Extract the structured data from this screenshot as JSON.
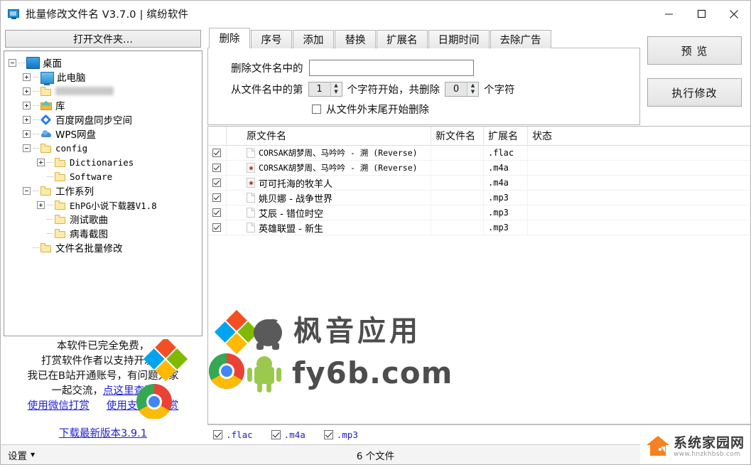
{
  "window": {
    "title": "批量修改文件名 V3.7.0 | 缤纷软件",
    "app_icon": "monitor-icon",
    "controls": {
      "minimize": "minimize-icon",
      "maximize": "maximize-icon",
      "close": "close-icon"
    }
  },
  "sidebar": {
    "open_folder_label": "打开文件夹…",
    "tree": [
      {
        "label": "桌面",
        "icon": "desktop-icon",
        "depth": 0,
        "expander": "minus",
        "redacted": false,
        "mono": false
      },
      {
        "label": "此电脑",
        "icon": "computer-icon",
        "depth": 1,
        "expander": "plus",
        "redacted": false,
        "mono": false
      },
      {
        "label": "",
        "icon": "folder-icon",
        "depth": 1,
        "expander": "plus",
        "redacted": true,
        "mono": false
      },
      {
        "label": "库",
        "icon": "library-icon",
        "depth": 1,
        "expander": "plus",
        "redacted": false,
        "mono": false
      },
      {
        "label": "百度网盘同步空间",
        "icon": "baidu-netdisk-icon",
        "depth": 1,
        "expander": "plus",
        "redacted": false,
        "mono": false
      },
      {
        "label": "WPS网盘",
        "icon": "wps-cloud-icon",
        "depth": 1,
        "expander": "plus",
        "redacted": false,
        "mono": false
      },
      {
        "label": "config",
        "icon": "folder-icon",
        "depth": 1,
        "expander": "minus",
        "redacted": false,
        "mono": true
      },
      {
        "label": "Dictionaries",
        "icon": "folder-icon",
        "depth": 2,
        "expander": "plus",
        "redacted": false,
        "mono": true
      },
      {
        "label": "Software",
        "icon": "folder-icon",
        "depth": 2,
        "expander": "none",
        "redacted": false,
        "mono": true
      },
      {
        "label": "工作系列",
        "icon": "folder-icon",
        "depth": 1,
        "expander": "minus",
        "redacted": false,
        "mono": false
      },
      {
        "label": "EhPG小说下载器V1.8",
        "icon": "folder-icon",
        "depth": 2,
        "expander": "plus",
        "redacted": false,
        "mono": true
      },
      {
        "label": "测试歌曲",
        "icon": "folder-icon",
        "depth": 2,
        "expander": "none",
        "redacted": false,
        "mono": false
      },
      {
        "label": "病毒截图",
        "icon": "folder-icon",
        "depth": 2,
        "expander": "none",
        "redacted": false,
        "mono": false
      },
      {
        "label": "文件名批量修改",
        "icon": "folder-icon",
        "depth": 1,
        "expander": "none",
        "redacted": false,
        "mono": false
      }
    ],
    "promo": {
      "line1": "本软件已完全免费，",
      "line2": "打赏软件作者以支持开发。",
      "line3": "我已在B站开通账号，有问题大家",
      "line4_prefix": "一起交流，",
      "line4_link": "点这里查看",
      "wechat_link": "使用微信打赏",
      "alipay_link": "使用支付宝打赏",
      "download_link": "下载最新版本3.9.1"
    }
  },
  "tabs": [
    {
      "label": "删除",
      "active": true
    },
    {
      "label": "序号",
      "active": false
    },
    {
      "label": "添加",
      "active": false
    },
    {
      "label": "替换",
      "active": false
    },
    {
      "label": "扩展名",
      "active": false
    },
    {
      "label": "日期时间",
      "active": false
    },
    {
      "label": "去除广告",
      "active": false
    }
  ],
  "delete_panel": {
    "remove_label": "删除文件名中的",
    "remove_value": "",
    "remove_placeholder": "",
    "from_label": "从文件名中的第",
    "start_value": "1",
    "mid_label": "个字符开始，共删除",
    "count_value": "0",
    "end_label": "个字符",
    "tail_checkbox_label": "从文件外末尾开始删除",
    "tail_checkbox_checked": false
  },
  "actions": {
    "preview_label": "预 览",
    "execute_label": "执行修改"
  },
  "file_table": {
    "columns": [
      "原文件名",
      "新文件名",
      "扩展名",
      "状态"
    ],
    "rows": [
      {
        "checked": true,
        "icon": "document-icon",
        "name": "CORSAK胡梦周、马吟吟 - 溯 (Reverse)",
        "newname": "",
        "ext": ".flac",
        "status": "",
        "mono": true
      },
      {
        "checked": true,
        "icon": "media-icon",
        "name": "CORSAK胡梦周、马吟吟 - 溯 (Reverse)",
        "newname": "",
        "ext": ".m4a",
        "status": "",
        "mono": true
      },
      {
        "checked": true,
        "icon": "media-icon",
        "name": "可可托海的牧羊人",
        "newname": "",
        "ext": ".m4a",
        "status": "",
        "mono": false
      },
      {
        "checked": true,
        "icon": "document-icon",
        "name": "姚贝娜 - 战争世界",
        "newname": "",
        "ext": ".mp3",
        "status": "",
        "mono": false
      },
      {
        "checked": true,
        "icon": "document-icon",
        "name": "艾辰 - 错位时空",
        "newname": "",
        "ext": ".mp3",
        "status": "",
        "mono": false
      },
      {
        "checked": true,
        "icon": "document-icon",
        "name": "英雄联盟 - 新生",
        "newname": "",
        "ext": ".mp3",
        "status": "",
        "mono": false
      }
    ]
  },
  "filter_bar": [
    {
      "label": ".flac",
      "checked": true
    },
    {
      "label": ".m4a",
      "checked": true
    },
    {
      "label": ".mp3",
      "checked": true
    }
  ],
  "status_bar": {
    "settings_label": "设置",
    "settings_caret": "chevron-down-icon",
    "file_count": "6 个文件"
  },
  "watermark": {
    "line1": "枫音应用",
    "line2": "fy6b.com"
  },
  "brand": {
    "name": "系统家园网",
    "url": "www.hnzkhbsb.com",
    "icon": "house-icon"
  },
  "colors": {
    "link": "#2020d8",
    "filter_text": "#1a1ad0",
    "brand_orange": "#f5811f",
    "accent_blue": "#1e90d8"
  }
}
